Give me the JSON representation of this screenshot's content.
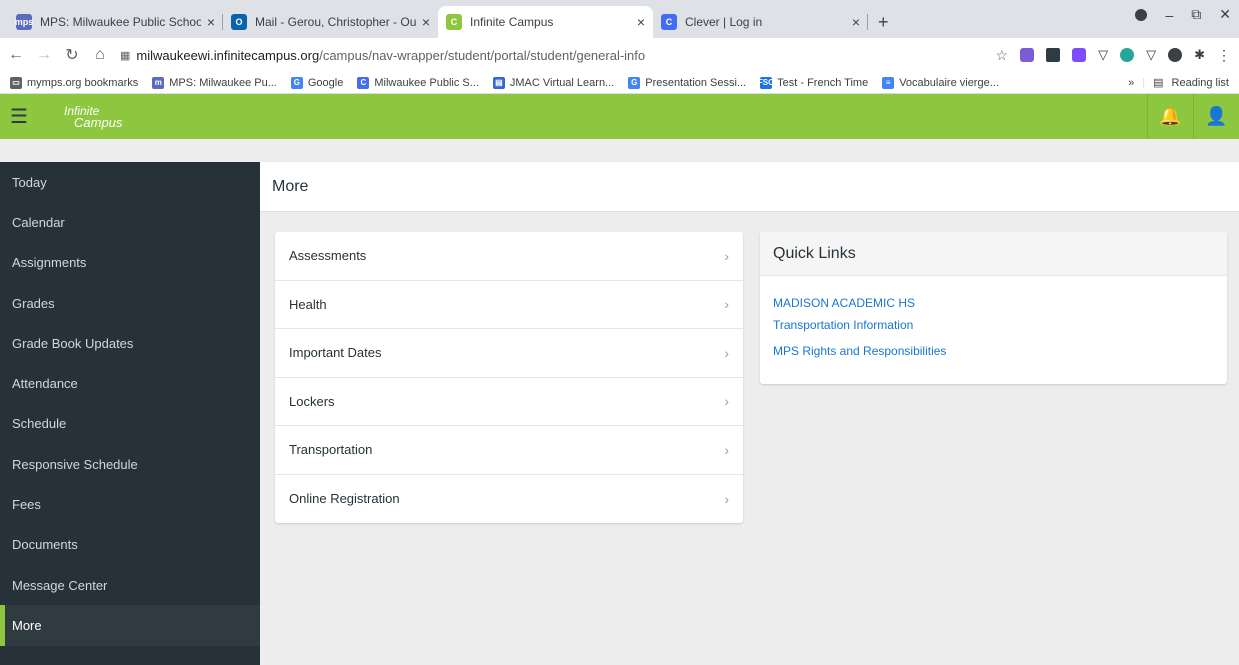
{
  "browser": {
    "tabs": [
      {
        "title": "MPS: Milwaukee Public Schools",
        "icon": "mps-favicon",
        "color": "#5c6bc0",
        "glyph": "mps"
      },
      {
        "title": "Mail - Gerou, Christopher - Outloo",
        "icon": "outlook-favicon",
        "color": "#0a64ad",
        "glyph": "O"
      },
      {
        "title": "Infinite Campus",
        "icon": "infinite-campus-favicon",
        "color": "#8dc63f",
        "glyph": "C"
      },
      {
        "title": "Clever | Log in",
        "icon": "clever-favicon",
        "color": "#436cf2",
        "glyph": "C"
      }
    ],
    "address": {
      "domain": "milwaukeewi.infinitecampus.org",
      "path": "/campus/nav-wrapper/student/portal/student/general-info"
    },
    "bookmarks": [
      {
        "label": "mymps.org bookmarks",
        "icon": "folder-icon",
        "color": "#5f6368",
        "glyph": "▭"
      },
      {
        "label": "MPS: Milwaukee Pu...",
        "icon": "mps-icon",
        "color": "#5c6bc0",
        "glyph": "m"
      },
      {
        "label": "Google",
        "icon": "google-icon",
        "color": "#4285f4",
        "glyph": "G"
      },
      {
        "label": "Milwaukee Public S...",
        "icon": "clever-icon",
        "color": "#436cf2",
        "glyph": "C"
      },
      {
        "label": "JMAC Virtual Learn...",
        "icon": "classroom-icon",
        "color": "#3367d6",
        "glyph": "▤"
      },
      {
        "label": "Presentation Sessi...",
        "icon": "google-icon",
        "color": "#4285f4",
        "glyph": "G"
      },
      {
        "label": "Test - French Time",
        "icon": "fso-icon",
        "color": "#1a73e8",
        "glyph": "FSO"
      },
      {
        "label": "Vocabulaire vierge...",
        "icon": "docs-icon",
        "color": "#4285f4",
        "glyph": "≡"
      }
    ],
    "overflow_label": "»",
    "reading_list": "Reading list"
  },
  "app": {
    "logo_line1": "Infinite",
    "logo_line2": "Campus",
    "accent": "#8dc63f",
    "sidebar_bg": "#263238"
  },
  "sidebar": {
    "items": [
      {
        "label": "Today",
        "key": "today"
      },
      {
        "label": "Calendar",
        "key": "calendar"
      },
      {
        "label": "Assignments",
        "key": "assignments"
      },
      {
        "label": "Grades",
        "key": "grades"
      },
      {
        "label": "Grade Book Updates",
        "key": "grade-book-updates"
      },
      {
        "label": "Attendance",
        "key": "attendance"
      },
      {
        "label": "Schedule",
        "key": "schedule"
      },
      {
        "label": "Responsive Schedule",
        "key": "responsive-schedule"
      },
      {
        "label": "Fees",
        "key": "fees"
      },
      {
        "label": "Documents",
        "key": "documents"
      },
      {
        "label": "Message Center",
        "key": "message-center"
      },
      {
        "label": "More",
        "key": "more"
      }
    ],
    "active": "more"
  },
  "page": {
    "title": "More",
    "menu": [
      {
        "label": "Assessments",
        "key": "assessments"
      },
      {
        "label": "Health",
        "key": "health"
      },
      {
        "label": "Important Dates",
        "key": "important-dates"
      },
      {
        "label": "Lockers",
        "key": "lockers"
      },
      {
        "label": "Transportation",
        "key": "transportation"
      },
      {
        "label": "Online Registration",
        "key": "online-registration"
      }
    ],
    "quick_links": {
      "title": "Quick Links",
      "links": [
        {
          "label": "MADISON ACADEMIC HS",
          "key": "madison-academic-hs"
        },
        {
          "label": "Transportation Information",
          "key": "transportation-information"
        },
        {
          "label": "MPS Rights and Responsibilities",
          "key": "mps-rights-and-responsibilities"
        }
      ]
    }
  }
}
